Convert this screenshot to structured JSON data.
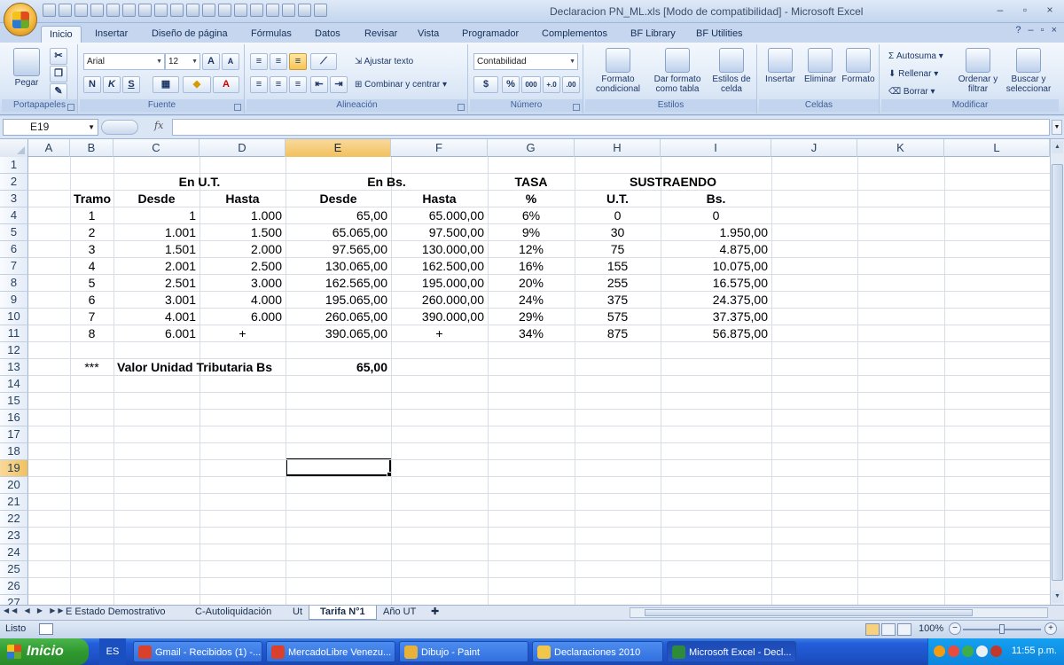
{
  "window": {
    "title": "Declaracion PN_ML.xls  [Modo de compatibilidad] - Microsoft Excel",
    "controls": [
      "–",
      "▫",
      "×"
    ]
  },
  "ribbon_tabs": [
    "Inicio",
    "Insertar",
    "Diseño de página",
    "Fórmulas",
    "Datos",
    "Revisar",
    "Vista",
    "Programador",
    "Complementos",
    "BF Library",
    "BF Utilities"
  ],
  "ribbon": {
    "clipboard": {
      "label": "Portapapeles",
      "paste": "Pegar"
    },
    "font": {
      "label": "Fuente",
      "name": "Arial",
      "size": "12",
      "bold": "N",
      "italic": "K",
      "underline": "S"
    },
    "alignment": {
      "label": "Alineación",
      "wrap": "Ajustar texto",
      "merge": "Combinar y centrar"
    },
    "number": {
      "label": "Número",
      "format": "Contabilidad",
      "percent": "%",
      "thousands": "000"
    },
    "styles": {
      "label": "Estilos",
      "conditional": "Formato condicional",
      "table": "Dar formato como tabla",
      "cell": "Estilos de celda"
    },
    "cells": {
      "label": "Celdas",
      "insert": "Insertar",
      "delete": "Eliminar",
      "format": "Formato"
    },
    "editing": {
      "label": "Modificar",
      "autosum": "Autosuma",
      "fill": "Rellenar",
      "clear": "Borrar",
      "sort": "Ordenar y filtrar",
      "find": "Buscar y seleccionar"
    }
  },
  "formula_bar": {
    "name_box": "E19",
    "fx": "fx",
    "content": ""
  },
  "columns": [
    "A",
    "B",
    "C",
    "D",
    "E",
    "F",
    "G",
    "H",
    "I",
    "J",
    "K",
    "L"
  ],
  "rows": [
    "1",
    "2",
    "3",
    "4",
    "5",
    "6",
    "7",
    "8",
    "9",
    "10",
    "11",
    "12",
    "13",
    "14",
    "15",
    "16",
    "17",
    "18",
    "19",
    "20",
    "21",
    "22",
    "23",
    "24",
    "25",
    "26",
    "27"
  ],
  "sheet": {
    "headers_row2": {
      "ut": "En U.T.",
      "bs": "En Bs.",
      "tasa": "TASA",
      "sustraendo": "SUSTRAENDO"
    },
    "headers_row3": {
      "tramo": "Tramo",
      "desde_ut": "Desde",
      "hasta_ut": "Hasta",
      "desde_bs": "Desde",
      "hasta_bs": "Hasta",
      "pct": "%",
      "ut": "U.T.",
      "bs": "Bs."
    },
    "tramos": [
      {
        "tramo": "1",
        "desde_ut": "1",
        "hasta_ut": "1.000",
        "desde_bs": "65,00",
        "hasta_bs": "65.000,00",
        "tasa": "6%",
        "sus_ut": "0",
        "sus_bs": "0"
      },
      {
        "tramo": "2",
        "desde_ut": "1.001",
        "hasta_ut": "1.500",
        "desde_bs": "65.065,00",
        "hasta_bs": "97.500,00",
        "tasa": "9%",
        "sus_ut": "30",
        "sus_bs": "1.950,00"
      },
      {
        "tramo": "3",
        "desde_ut": "1.501",
        "hasta_ut": "2.000",
        "desde_bs": "97.565,00",
        "hasta_bs": "130.000,00",
        "tasa": "12%",
        "sus_ut": "75",
        "sus_bs": "4.875,00"
      },
      {
        "tramo": "4",
        "desde_ut": "2.001",
        "hasta_ut": "2.500",
        "desde_bs": "130.065,00",
        "hasta_bs": "162.500,00",
        "tasa": "16%",
        "sus_ut": "155",
        "sus_bs": "10.075,00"
      },
      {
        "tramo": "5",
        "desde_ut": "2.501",
        "hasta_ut": "3.000",
        "desde_bs": "162.565,00",
        "hasta_bs": "195.000,00",
        "tasa": "20%",
        "sus_ut": "255",
        "sus_bs": "16.575,00"
      },
      {
        "tramo": "6",
        "desde_ut": "3.001",
        "hasta_ut": "4.000",
        "desde_bs": "195.065,00",
        "hasta_bs": "260.000,00",
        "tasa": "24%",
        "sus_ut": "375",
        "sus_bs": "24.375,00"
      },
      {
        "tramo": "7",
        "desde_ut": "4.001",
        "hasta_ut": "6.000",
        "desde_bs": "260.065,00",
        "hasta_bs": "390.000,00",
        "tasa": "29%",
        "sus_ut": "575",
        "sus_bs": "37.375,00"
      },
      {
        "tramo": "8",
        "desde_ut": "6.001",
        "hasta_ut": "+",
        "desde_bs": "390.065,00",
        "hasta_bs": "+",
        "tasa": "34%",
        "sus_ut": "875",
        "sus_bs": "56.875,00"
      }
    ],
    "note": {
      "marker": "***",
      "label": "Valor Unidad Tributaria Bs",
      "value": "65,00"
    }
  },
  "sheet_tabs": [
    "E Estado Demostrativo",
    "C-Autoliquidación",
    "Ut",
    "Tarifa N°1",
    "Año UT"
  ],
  "active_sheet": "Tarifa N°1",
  "status": {
    "text": "Listo",
    "zoom": "100%",
    "zoom_level": 0.5
  },
  "taskbar": {
    "start": "Inicio",
    "lang": "ES",
    "tasks": [
      {
        "label": "Gmail - Recibidos (1) -...",
        "color": "#d9412c"
      },
      {
        "label": "MercadoLibre Venezu...",
        "color": "#d9412c"
      },
      {
        "label": "Dibujo - Paint",
        "color": "#e8b23a"
      },
      {
        "label": "Declaraciones 2010",
        "color": "#f1c64a"
      },
      {
        "label": "Microsoft Excel - Decl...",
        "color": "#2e8b3a"
      }
    ],
    "clock": "11:55 p.m."
  }
}
